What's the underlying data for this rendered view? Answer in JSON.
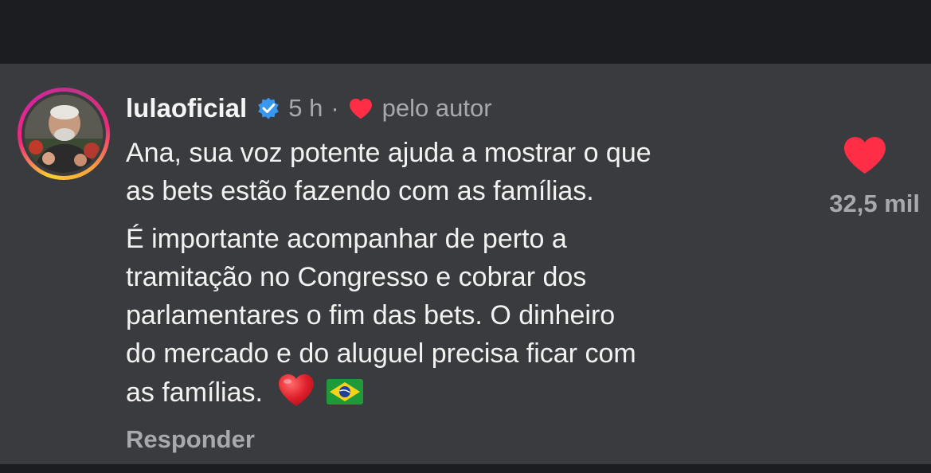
{
  "comment": {
    "username": "lulaoficial",
    "verified_icon": "verified-badge-icon",
    "time_ago": "5 h",
    "separator": "·",
    "liked_by_label": "pelo autor",
    "paragraphs": [
      "Ana, sua voz potente ajuda a mostrar o que\nas bets estão fazendo com as famílias.",
      "É importante acompanhar de perto a\ntramitação no Congresso e cobrar dos\nparlamentares o fim das bets. O dinheiro\ndo mercado e do aluguel precisa ficar com\nas famílias."
    ],
    "emojis": [
      "red-heart-emoji",
      "brazil-flag-emoji"
    ],
    "reply_label": "Responder",
    "like_count": "32,5 mil"
  },
  "colors": {
    "background": "#3a3b3f",
    "heart": "#ff2d46",
    "verified": "#3897f0",
    "secondary_text": "#a8a9ad"
  }
}
